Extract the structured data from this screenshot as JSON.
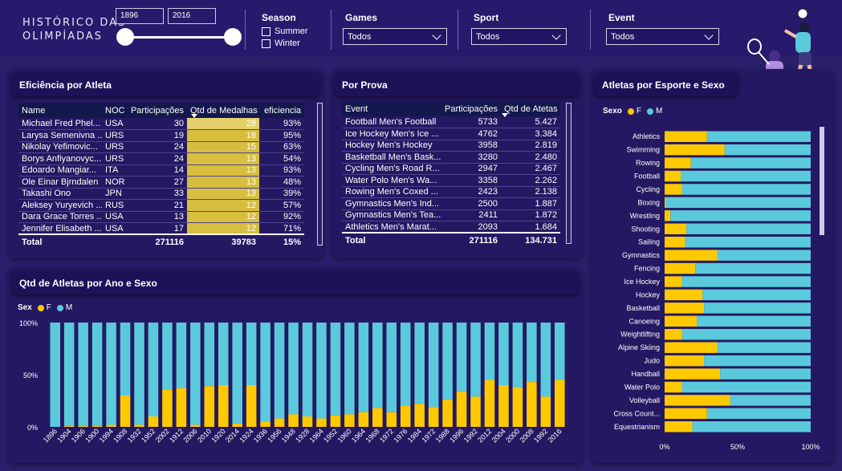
{
  "header": {
    "logo_line1": "HISTÓRICO DAS",
    "logo_line2": "OLIMPÍADAS",
    "year_from": "1896",
    "year_to": "2016",
    "season_label": "Season",
    "season_options": [
      "Summer",
      "Winter"
    ],
    "games_label": "Games",
    "games_value": "Todos",
    "sport_label": "Sport",
    "sport_value": "Todos",
    "event_label": "Event",
    "event_value": "Todos"
  },
  "eficiencia": {
    "title": "Eficiência por Atleta",
    "columns": [
      "Name",
      "NOC",
      "Participações",
      "Qtd de Medalhas",
      "eficiencia"
    ],
    "rows": [
      [
        "Michael Fred Phel...",
        "USA",
        "30",
        "28",
        "93%"
      ],
      [
        "Larysa Semenivna ...",
        "URS",
        "19",
        "18",
        "95%"
      ],
      [
        "Nikolay Yefimovic...",
        "URS",
        "24",
        "15",
        "63%"
      ],
      [
        "Borys Anfiyanovyc...",
        "URS",
        "24",
        "13",
        "54%"
      ],
      [
        "Edoardo Mangiar...",
        "ITA",
        "14",
        "13",
        "93%"
      ],
      [
        "Ole Einar Bjrndalen",
        "NOR",
        "27",
        "13",
        "48%"
      ],
      [
        "Takashi Ono",
        "JPN",
        "33",
        "13",
        "39%"
      ],
      [
        "Aleksey Yuryevich ...",
        "RUS",
        "21",
        "12",
        "57%"
      ],
      [
        "Dara Grace Torres ...",
        "USA",
        "13",
        "12",
        "92%"
      ],
      [
        "Jennifer Elisabeth ...",
        "USA",
        "17",
        "12",
        "71%"
      ]
    ],
    "total": [
      "Total",
      "",
      "271116",
      "39783",
      "15%"
    ]
  },
  "prova": {
    "title": "Por Prova",
    "columns": [
      "Event",
      "Participações",
      "Qtd de Atetas"
    ],
    "rows": [
      [
        "Football Men's Football",
        "5733",
        "5.427"
      ],
      [
        "Ice Hockey Men's Ice ...",
        "4762",
        "3.384"
      ],
      [
        "Hockey Men's Hockey",
        "3958",
        "2.819"
      ],
      [
        "Basketball Men's Bask...",
        "3280",
        "2.480"
      ],
      [
        "Cycling Men's Road R...",
        "2947",
        "2.467"
      ],
      [
        "Water Polo Men's Wa...",
        "3358",
        "2.262"
      ],
      [
        "Rowing Men's Coxed ...",
        "2423",
        "2.138"
      ],
      [
        "Gymnastics Men's Ind...",
        "2500",
        "1.887"
      ],
      [
        "Gymnastics Men's Tea...",
        "2411",
        "1.872"
      ],
      [
        "Athletics Men's Marat...",
        "2093",
        "1.684"
      ]
    ],
    "total": [
      "Total",
      "271116",
      "134.731"
    ]
  },
  "chart_data": [
    {
      "type": "bar",
      "stacked": "100%",
      "title": "Qtd de Atletas por Ano e Sexo",
      "legend_title": "Sex",
      "categories": [
        "1896",
        "1904",
        "1906",
        "1900",
        "1994",
        "1908",
        "1932",
        "1952",
        "2002",
        "1912",
        "2006",
        "2010",
        "1920",
        "2014",
        "1924",
        "1936",
        "1956",
        "1948",
        "1928",
        "1964",
        "1952",
        "1960",
        "1964",
        "1968",
        "1972",
        "1976",
        "1984",
        "1972",
        "1988",
        "1996",
        "1992",
        "2012",
        "2004",
        "2000",
        "2008",
        "1992",
        "2016"
      ],
      "series": [
        {
          "name": "F",
          "color": "#ffc900",
          "values": [
            0,
            1,
            1,
            1,
            2,
            30,
            2,
            10,
            36,
            37,
            2,
            39,
            40,
            3,
            40,
            5,
            8,
            12,
            10,
            8,
            11,
            12,
            14,
            18,
            14,
            20,
            22,
            19,
            26,
            34,
            29,
            45,
            40,
            38,
            43,
            29,
            45
          ]
        },
        {
          "name": "M",
          "color": "#5ac9dc",
          "values": [
            100,
            99,
            99,
            99,
            98,
            70,
            98,
            90,
            64,
            63,
            98,
            61,
            60,
            97,
            60,
            95,
            92,
            88,
            90,
            92,
            89,
            88,
            86,
            82,
            86,
            80,
            78,
            81,
            74,
            66,
            71,
            55,
            60,
            62,
            57,
            71,
            55
          ]
        }
      ],
      "ylim": [
        0,
        100
      ],
      "yticks": [
        "0%",
        "50%",
        "100%"
      ]
    },
    {
      "type": "bar",
      "orientation": "horizontal",
      "stacked": "100%",
      "title": "Atletas por Esporte e Sexo",
      "legend_title": "Sexo",
      "categories": [
        "Athletics",
        "Swimming",
        "Rowing",
        "Football",
        "Cycling",
        "Boxing",
        "Wrestling",
        "Shooting",
        "Sailing",
        "Gymnastics",
        "Fencing",
        "Ice Hockey",
        "Hockey",
        "Basketball",
        "Canoeing",
        "Weightlifting",
        "Alpine Skiing",
        "Judo",
        "Handball",
        "Water Polo",
        "Volleyball",
        "Cross Count...",
        "Equestrianism"
      ],
      "series": [
        {
          "name": "F",
          "color": "#ffc900",
          "values": [
            29,
            41,
            18,
            11,
            12,
            1,
            4,
            15,
            14,
            36,
            21,
            12,
            26,
            27,
            22,
            12,
            36,
            27,
            38,
            12,
            45,
            29,
            19
          ]
        },
        {
          "name": "M",
          "color": "#5ac9dc",
          "values": [
            71,
            59,
            82,
            89,
            88,
            99,
            96,
            85,
            86,
            64,
            79,
            88,
            74,
            73,
            78,
            88,
            64,
            73,
            62,
            88,
            55,
            71,
            81
          ]
        }
      ],
      "xlim": [
        0,
        100
      ],
      "xticks": [
        "0%",
        "50%",
        "100%"
      ]
    }
  ]
}
